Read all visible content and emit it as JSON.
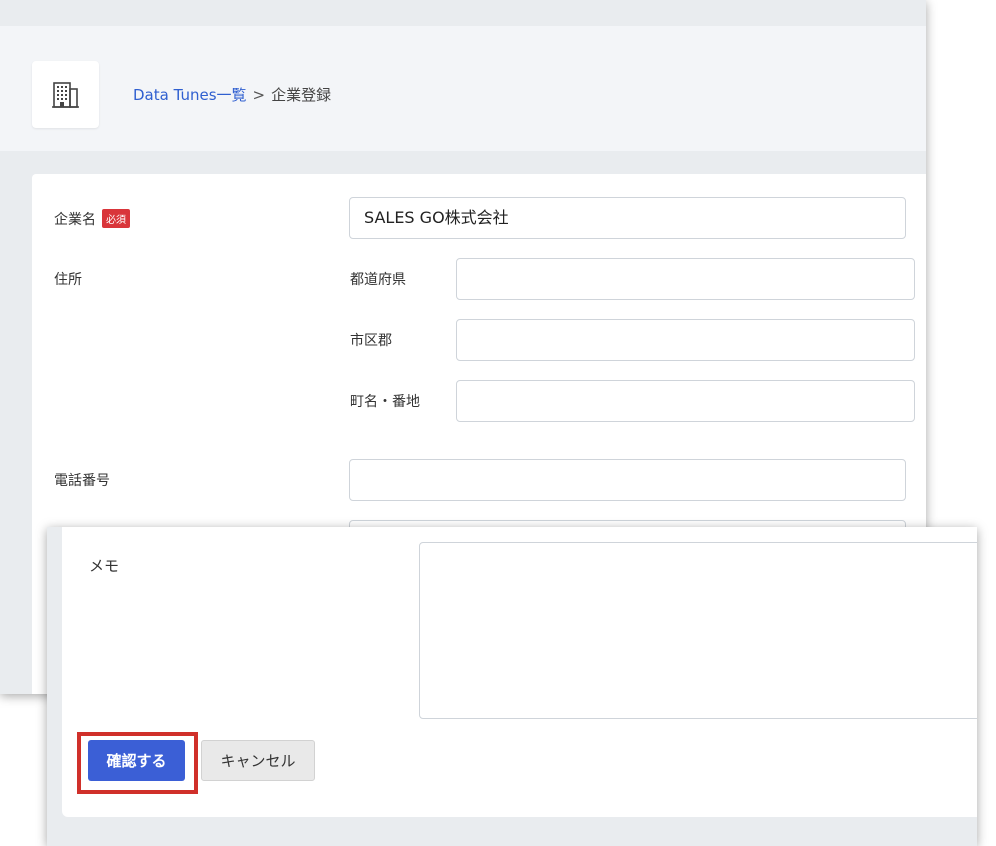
{
  "breadcrumb": {
    "list_link": "Data Tunes一覧",
    "separator": ">",
    "current": "企業登録"
  },
  "form": {
    "company_name": {
      "label": "企業名",
      "required_badge": "必須",
      "value": "SALES GO株式会社"
    },
    "address": {
      "label": "住所",
      "prefecture_label": "都道府県",
      "prefecture_value": "",
      "city_label": "市区郡",
      "city_value": "",
      "town_label": "町名・番地",
      "town_value": ""
    },
    "phone": {
      "label": "電話番号",
      "value": ""
    }
  },
  "memo": {
    "label": "メモ",
    "value": ""
  },
  "actions": {
    "confirm_label": "確認する",
    "cancel_label": "キャンセル"
  },
  "colors": {
    "primary": "#3b5fd6",
    "required_badge": "#d9353a",
    "highlight_border": "#d0302a",
    "link": "#2f5fd0"
  },
  "icons": {
    "logo": "building-icon"
  }
}
